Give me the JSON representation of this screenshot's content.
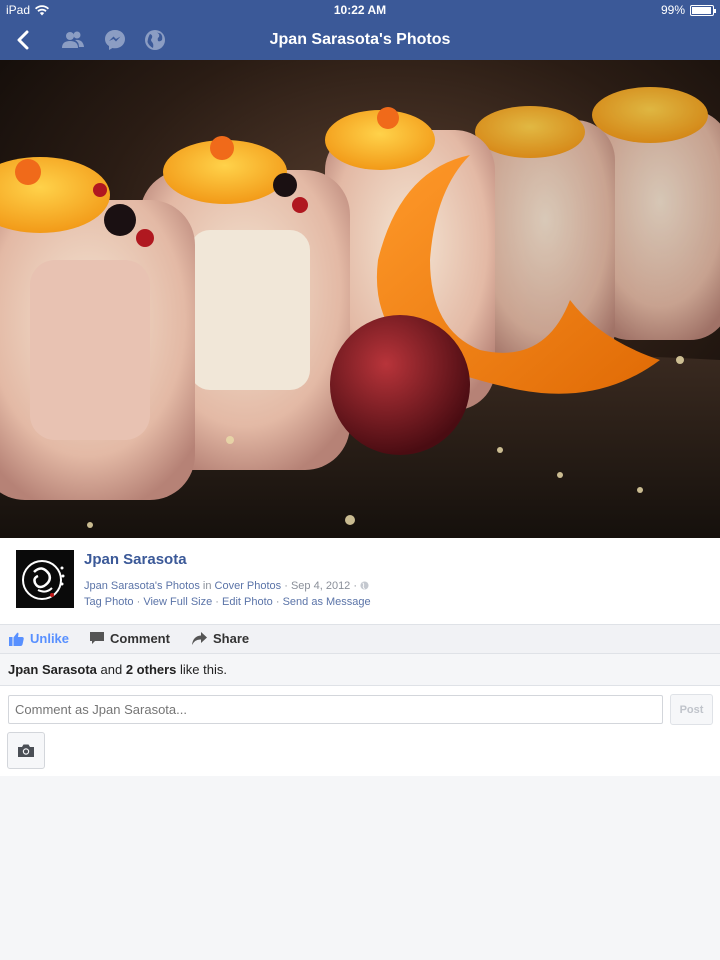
{
  "status_bar": {
    "device": "iPad",
    "time": "10:22 AM",
    "battery": "99%"
  },
  "nav": {
    "title": "Jpan Sarasota's Photos",
    "icons": [
      "back-icon",
      "friends-icon",
      "messenger-icon",
      "globe-icon"
    ]
  },
  "post": {
    "author": "Jpan Sarasota",
    "album_link": "Jpan Sarasota's Photos",
    "in_text": "in",
    "album_name": "Cover Photos",
    "date": "· Sep 4, 2012 ·",
    "links": [
      "Tag Photo",
      "View Full Size",
      "Edit Photo",
      "Send as Message"
    ],
    "separator": "·"
  },
  "actions": {
    "unlike": "Unlike",
    "comment": "Comment",
    "share": "Share"
  },
  "likes": {
    "name": "Jpan Sarasota",
    "and": "and",
    "others": "2 others",
    "suffix": "like this."
  },
  "compose": {
    "placeholder": "Comment as Jpan Sarasota...",
    "post_label": "Post"
  },
  "colors": {
    "brand": "#3b5998",
    "link": "#5b74a8",
    "unlike": "#5890ff"
  }
}
